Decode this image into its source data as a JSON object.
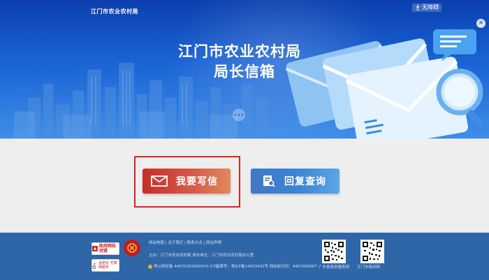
{
  "header": {
    "site_name": "江门市农业农村局",
    "accessibility_label": "无障碍",
    "close_label": "×",
    "title_line1": "江门市农业农村局",
    "title_line2": "局长信箱"
  },
  "actions": {
    "write_label": "我要写信",
    "query_label": "回复查询"
  },
  "footer": {
    "links_line": "网站地图 | 关于我们 | 联系方式 | 网站声明",
    "host_line": "主办：江门市农业农村局   承办单位：江门市农业农村局办公室",
    "record_line": "粤公网安备 44070302000470   ICP备案号：粤ICP备14003432号   网站标识码：4407000007",
    "badge_gov_text": "政府网站找错",
    "badge_acc_text": "适老化 无障碍服务",
    "qr1_label": "广东省政务服务网",
    "qr2_label": "江门市政府网"
  },
  "colors": {
    "banner_top": "#0b3fae",
    "banner_bottom": "#3f8ee8",
    "write_button": "#c52f25",
    "query_button": "#3e78c4",
    "footer": "#2f66a8",
    "highlight": "#e0201c"
  },
  "icons": {
    "accessibility": "accessibility-icon",
    "close": "close-icon",
    "write": "envelope-icon",
    "query": "document-search-icon",
    "police": "police-badge-icon",
    "emblem": "party-emblem-icon"
  }
}
